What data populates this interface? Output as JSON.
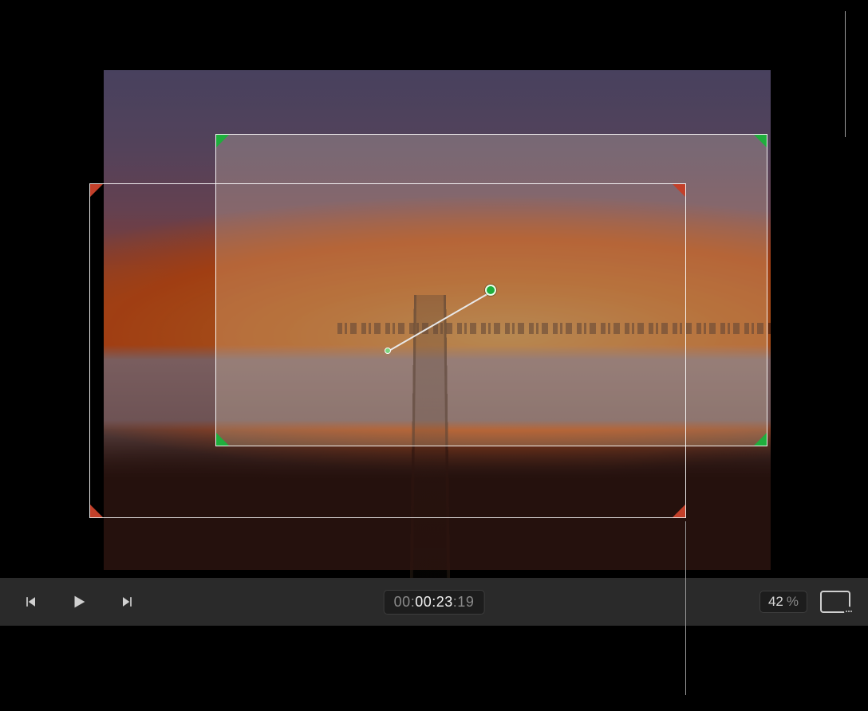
{
  "timecode": {
    "hours": "00",
    "minutes": "00",
    "seconds": "23",
    "frames": "19"
  },
  "zoom": {
    "value": "42",
    "unit": "%"
  },
  "frames": {
    "start": {
      "color": "#c2402a",
      "role": "start-crop-frame"
    },
    "end": {
      "color": "#1fae3d",
      "role": "end-crop-frame"
    }
  },
  "icons": {
    "prev": "previous-frame",
    "play": "play",
    "next": "next-frame",
    "viewMenu": "view-options"
  }
}
